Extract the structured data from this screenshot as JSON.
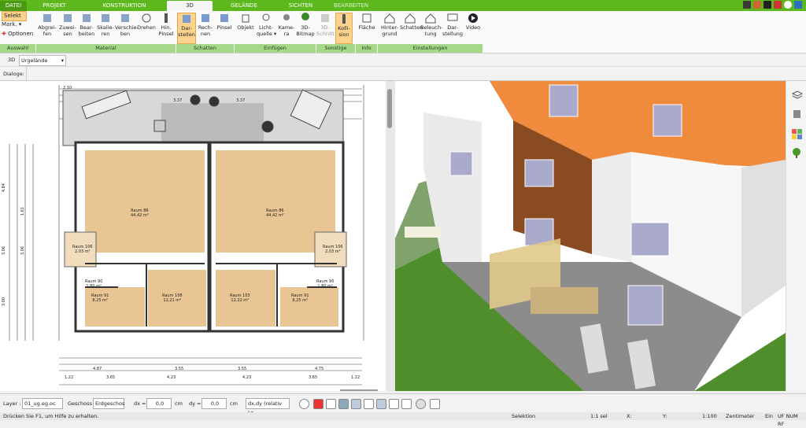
{
  "tabs": [
    "DATEI",
    "PROJEKT",
    "KONSTRUKTION",
    "3D",
    "GELÄNDE",
    "SICHTEN",
    "BEARBEITEN"
  ],
  "ribbon": {
    "auswahl": {
      "selekt": "Selekt",
      "mark": "Mark.",
      "optionen": "Optionen"
    },
    "buttons": [
      "Abgrei-\nfen",
      "Zuwei-\nsen",
      "Bear-\nbeiten",
      "Skalie-\nren",
      "Verschie-\nben",
      "Drehen",
      "Hin.\nPinsel",
      "Dar-\nstellen",
      "Rech-\nnen",
      "Pinsel",
      "Objekt",
      "Licht-\nquelle ▾",
      "Kame-\nra",
      "3D-\nBitmap",
      "3D-\nSchnitt",
      "Kolli-\nsion",
      "Fläche",
      "Hinter-\ngrund",
      "Schatten",
      "Beleuch-\ntung",
      "Dar-\nstellung",
      "Video"
    ],
    "groups": [
      "Auswahl",
      "Material",
      "Schatten",
      "Einfügen",
      "Sonstige",
      "Info",
      "Einstellungen"
    ]
  },
  "toolbar": {
    "view": "3D",
    "terrain": "Urgelände",
    "dialog": "Dialoge:"
  },
  "rooms": [
    {
      "name": "Raum 86",
      "area": "44,42 m²"
    },
    {
      "name": "Raum 86",
      "area": "44,42 m²"
    },
    {
      "name": "Raum 106",
      "area": "2,03 m²"
    },
    {
      "name": "Raum 106",
      "area": "2,03 m²"
    },
    {
      "name": "Raum 90",
      "area": "1,80 m²"
    },
    {
      "name": "Raum 90",
      "area": "1,80 m²"
    },
    {
      "name": "Raum 91",
      "area": "8,25 m²"
    },
    {
      "name": "Raum 91",
      "area": "8,25 m²"
    },
    {
      "name": "Raum 108",
      "area": "12,21 m²"
    },
    {
      "name": "Raum 103",
      "area": "12,22 m²"
    }
  ],
  "dims": {
    "top1": "2.10",
    "top2": "3.37",
    "top3": "3.37",
    "bottom1": "4.87",
    "bottom2": "3.55",
    "bottom3": "3.55",
    "bottom4": "4.75",
    "bottom5": "3.65",
    "bottom6": "4.23",
    "bottom7": "4.23",
    "bottom8": "3.65",
    "bottom9": "1.22",
    "bottom10": "1.22",
    "left1": "4.84",
    "left2": "3.06",
    "left3": "3.00",
    "left4": "1.61",
    "left5": "3.06"
  },
  "bottombar": {
    "layer_label": "Layer :",
    "layer_value": "01_ug.eg.oc",
    "geschoss_label": "Geschoss :",
    "geschoss_value": "Erdgeschos",
    "dx": "dx =",
    "dx_val": "0,0",
    "cm1": "cm",
    "dy": "dy =",
    "dy_val": "0,0",
    "cm2": "cm",
    "mode": "dx,dy (relativ kz"
  },
  "status": {
    "help": "Drücken Sie F1, um Hilfe zu erhalten.",
    "sel": "Selektion",
    "count": "1:1 sel",
    "x": "X:",
    "y": "Y:",
    "scale": "1:100",
    "unit": "Zentimeter",
    "ein": "Ein",
    "flags": "UF NUM RF"
  },
  "colors": {
    "green": "#5cb81c",
    "groupgreen": "#a6d88a",
    "accent": "#fbd28e"
  }
}
